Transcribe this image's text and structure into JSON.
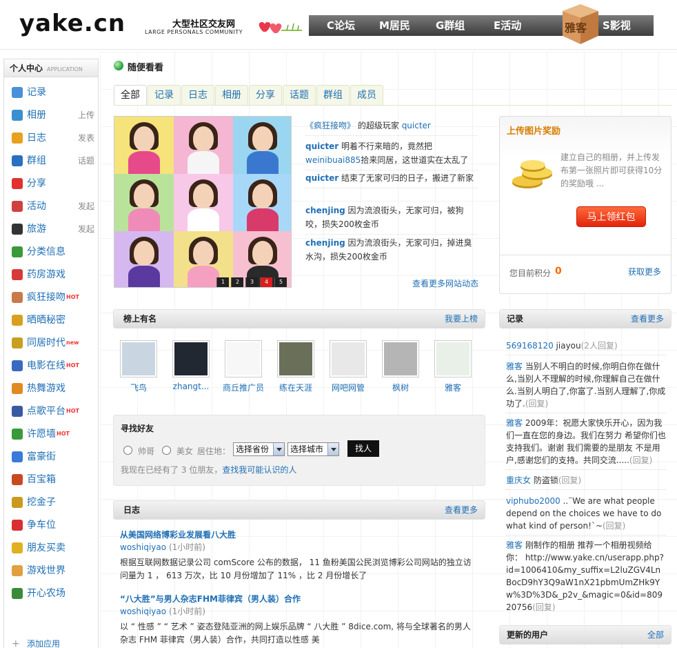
{
  "header": {
    "logo": "yake.cn",
    "slogan": "大型社区交友网",
    "slogan_en": "LARGE PERSONALS COMMUNITY",
    "nav": [
      {
        "label": "C论坛"
      },
      {
        "label": "M居民"
      },
      {
        "label": "G群组"
      },
      {
        "label": "E活动"
      },
      {
        "label": "S影视"
      }
    ],
    "box_text": "雅客"
  },
  "sidebar": {
    "title": "个人中心",
    "title_en": "APPLICATION",
    "items": [
      {
        "label": "记录",
        "action": "",
        "icon": "chat-bubble-icon",
        "color": "#4a90d9",
        "hot": ""
      },
      {
        "label": "相册",
        "action": "上传",
        "icon": "photo-icon",
        "color": "#3a8fd0",
        "hot": ""
      },
      {
        "label": "日志",
        "action": "发表",
        "icon": "journal-icon",
        "color": "#e8a020",
        "hot": ""
      },
      {
        "label": "群组",
        "action": "话题",
        "icon": "group-icon",
        "color": "#2a6fc0",
        "hot": ""
      },
      {
        "label": "分享",
        "action": "",
        "icon": "heart-icon",
        "color": "#e03030",
        "hot": ""
      },
      {
        "label": "活动",
        "action": "发起",
        "icon": "calendar-icon",
        "color": "#d04040",
        "hot": ""
      },
      {
        "label": "旅游",
        "action": "发起",
        "icon": "travel-icon",
        "color": "#333333",
        "hot": ""
      },
      {
        "label": "分类信息",
        "action": "",
        "icon": "bars-icon",
        "color": "#3a9a3a",
        "hot": ""
      },
      {
        "label": "药房游戏",
        "action": "",
        "icon": "medicine-icon",
        "color": "#d83a3a",
        "hot": ""
      },
      {
        "label": "疯狂接吻",
        "action": "",
        "icon": "kiss-icon",
        "color": "#c87a4a",
        "hot": "HOT"
      },
      {
        "label": "晒晒秘密",
        "action": "",
        "icon": "secret-icon",
        "color": "#d8a020",
        "hot": ""
      },
      {
        "label": "同居时代",
        "action": "",
        "icon": "house-icon",
        "color": "#c8a020",
        "hot": "new"
      },
      {
        "label": "电影在线",
        "action": "",
        "icon": "film-icon",
        "color": "#3a6ac0",
        "hot": "HOT"
      },
      {
        "label": "热舞游戏",
        "action": "",
        "icon": "dance-icon",
        "color": "#e08a20",
        "hot": ""
      },
      {
        "label": "点歌平台",
        "action": "",
        "icon": "music-icon",
        "color": "#3a5aa0",
        "hot": "HOT"
      },
      {
        "label": "许愿墙",
        "action": "",
        "icon": "wish-icon",
        "color": "#3a9a3a",
        "hot": "HOT"
      },
      {
        "label": "富豪街",
        "action": "",
        "icon": "diamond-icon",
        "color": "#3a7ad8",
        "hot": ""
      },
      {
        "label": "百宝箱",
        "action": "",
        "icon": "treasure-icon",
        "color": "#c84a20",
        "hot": ""
      },
      {
        "label": "挖金子",
        "action": "",
        "icon": "gold-icon",
        "color": "#c89a20",
        "hot": ""
      },
      {
        "label": "争车位",
        "action": "",
        "icon": "parking-icon",
        "color": "#d83030",
        "hot": ""
      },
      {
        "label": "朋友买卖",
        "action": "",
        "icon": "coins-icon",
        "color": "#e0b020",
        "hot": ""
      },
      {
        "label": "游戏世界",
        "action": "",
        "icon": "game-icon",
        "color": "#e0a040",
        "hot": ""
      },
      {
        "label": "开心农场",
        "action": "",
        "icon": "farm-icon",
        "color": "#3a8a3a",
        "hot": ""
      },
      {
        "label": "添加应用",
        "action": "",
        "icon": "plus-icon",
        "color": "#999999",
        "hot": ""
      }
    ]
  },
  "main": {
    "title": "随便看看",
    "tabs": [
      {
        "label": "全部"
      },
      {
        "label": "记录"
      },
      {
        "label": "日志"
      },
      {
        "label": "相册"
      },
      {
        "label": "分享"
      },
      {
        "label": "话题"
      },
      {
        "label": "群组"
      },
      {
        "label": "成员"
      }
    ],
    "pager": [
      "1",
      "2",
      "3",
      "4",
      "5"
    ],
    "feed": [
      {
        "pre": "《疯狂接吻》",
        "user": "",
        "mid": "的超级玩家",
        "link": "quicter",
        "text": ""
      },
      {
        "pre": "",
        "user": "quicter",
        "mid": "明着不行来暗的，竟然把",
        "link": "weinibuai885",
        "text": "拾来同居，这世道实在太乱了"
      },
      {
        "pre": "",
        "user": "quicter",
        "mid": "结束了无家可归的日子，搬进了新家",
        "link": "",
        "text": ""
      },
      {
        "pre": "",
        "user": "chenjing",
        "mid": "因为流浪街头，无家可归，被狗咬，损失200枚金币",
        "link": "",
        "text": ""
      },
      {
        "pre": "",
        "user": "chenjing",
        "mid": "因为流浪街头，无家可归，掉进臭水沟，损失200枚金币",
        "link": "",
        "text": ""
      }
    ],
    "feed_more": "查看更多网站动态",
    "top_title": "榜上有名",
    "top_more": "我要上榜",
    "members": [
      {
        "name": "飞鸟"
      },
      {
        "name": "zhangt..."
      },
      {
        "name": "商丘推广员"
      },
      {
        "name": "练在天涯"
      },
      {
        "name": "网吧网管"
      },
      {
        "name": "枫树"
      },
      {
        "name": "雅客"
      }
    ],
    "find": {
      "title": "寻找好友",
      "male": "帅哥",
      "female": "美女",
      "location_label": "居住地：",
      "province": "选择省份",
      "city": "选择城市",
      "button": "找人",
      "info_pre": "我现在已经有了",
      "count": "3",
      "info_unit": "位朋友，",
      "info_link": "查找我可能认识的人"
    },
    "blog_title": "日志",
    "blog_more": "查看更多",
    "blogs": [
      {
        "title": "从美国网络博彩业发展看八大胜",
        "author": "woshiqiyao",
        "time": "(1小时前)",
        "body": "根据互联网数据记录公司 comScore 公布的数据， 11 鱼粉美国公民浏览博彩公司网站的独立访问量为 1 ， 613 万次，比 10 月份增加了 11% ，比 2 月份增长了"
      },
      {
        "title": "“八大胜”与男人杂志FHM菲律宾（男人装）合作",
        "author": "woshiqiyao",
        "time": "(1小时前)",
        "body": "以 “ 性感 ” “ 艺术 ” 姿态登陆亚洲的网上娱乐品牌 “ 八大胜 ” 8dice.com, 将与全球著名的男人杂志 FHM 菲律宾（男人装）合作，共同打造以性感 美"
      }
    ]
  },
  "right": {
    "reward_title": "上传图片奖励",
    "reward_desc": "建立自己的相册，并上传发布第一张照片即可获得10分的奖励哦 ...",
    "reward_button": "马上领红包",
    "score_label": "您目前积分",
    "score": "0",
    "score_more": "获取更多",
    "notes_title": "记录",
    "notes_more": "查看更多",
    "notes": [
      {
        "user": "569168120",
        "text": "jiayou",
        "reply": "(2人回复)"
      },
      {
        "user": "雅客",
        "text": "当别人不明白的时候,你明白你在做什么,当别人不理解的时候,你理解自己在做什么.当别人明白了,你富了.当别人理解了,你成功了.",
        "reply": "(回复)"
      },
      {
        "user": "雅客",
        "text": "2009年：祝愿大家快乐开心，因为我们一直在您的身边。我们在努力 希望你们也支持我们。谢谢 我们需要的是朋友 不是用户,感谢您们的支持。共同交流.....",
        "reply": "(回复)"
      },
      {
        "user": "重庆女",
        "text": "防盗锁",
        "reply": "(回复)"
      },
      {
        "user": "viphubo2000",
        "text": "..¨We are what people depend on the choices we have to do what kind of person!`~",
        "reply": "(回复)"
      },
      {
        "user": "雅客",
        "text": "刚制作的相册 推荐一个相册视频给你： http://www.yake.cn/userapp.php?id=1006410&my_suffix=L2luZGV4LnBocD9hY3Q9aW1nX21pbmUmZHk9Yw%3D%3D&_p2v_&magic=0&id=80920756",
        "reply": "(回复)"
      }
    ],
    "users_title": "更新的用户",
    "users_more": "全部"
  }
}
